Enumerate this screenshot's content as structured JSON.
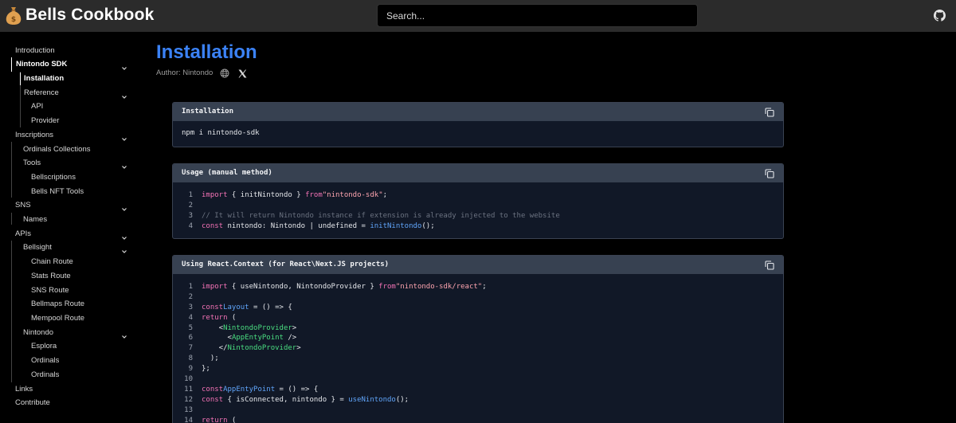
{
  "header": {
    "logo_icon": "money-bag-icon",
    "title": "Bells Cookbook",
    "search_placeholder": "Search...",
    "github_icon": "github-icon"
  },
  "sidebar": {
    "items": [
      {
        "label": "Introduction"
      },
      {
        "label": "Nintondo SDK"
      },
      {
        "label": "Installation"
      },
      {
        "label": "Reference"
      },
      {
        "label": "API"
      },
      {
        "label": "Provider"
      },
      {
        "label": "Inscriptions"
      },
      {
        "label": "Ordinals Collections"
      },
      {
        "label": "Tools"
      },
      {
        "label": "Bellscriptions"
      },
      {
        "label": "Bells NFT Tools"
      },
      {
        "label": "SNS"
      },
      {
        "label": "Names"
      },
      {
        "label": "APIs"
      },
      {
        "label": "Bellsight"
      },
      {
        "label": "Chain Route"
      },
      {
        "label": "Stats Route"
      },
      {
        "label": "SNS Route"
      },
      {
        "label": "Bellmaps Route"
      },
      {
        "label": "Mempool Route"
      },
      {
        "label": "Nintondo"
      },
      {
        "label": "Esplora"
      },
      {
        "label": "Ordinals"
      },
      {
        "label": "Ordinals"
      },
      {
        "label": "Links"
      },
      {
        "label": "Contribute"
      }
    ]
  },
  "main": {
    "title": "Installation",
    "author": "Author: Nintondo",
    "blocks": [
      {
        "title": "Installation",
        "lines": [
          "npm i nintondo-sdk"
        ]
      },
      {
        "title": "Usage (manual method)",
        "numbers": [
          "1",
          "2",
          "3",
          "4"
        ],
        "lines": [
          "import { initNintondo } from \"nintondo-sdk\";",
          "",
          "// It will return Nintondo instance if extension is already injected to the website",
          "const nintondo: Nintondo | undefined = initNintondo();"
        ]
      },
      {
        "title": "Using React.Context (for React\\Next.JS projects)",
        "numbers": [
          "1",
          "2",
          "3",
          "4",
          "5",
          "6",
          "7",
          "8",
          "9",
          "10",
          "11",
          "12",
          "13",
          "14"
        ],
        "lines": [
          "import { useNintondo, NintondoProvider } from \"nintondo-sdk/react\";",
          "",
          "const Layout = () => {",
          "  return (",
          "    <NintondoProvider>",
          "      <AppEntyPoint />",
          "    </NintondoProvider>",
          "  );",
          "};",
          "",
          "const AppEntyPoint = () => {",
          "  const { isConnected, nintondo } = useNintondo();",
          "",
          "  return ("
        ]
      }
    ]
  },
  "colors": {
    "accent": "#3b82f6",
    "keyword": "#f472b6",
    "string": "#fda4af",
    "function": "#60a5fa",
    "comment": "#6b7280",
    "jsx_tag": "#4ade80"
  }
}
